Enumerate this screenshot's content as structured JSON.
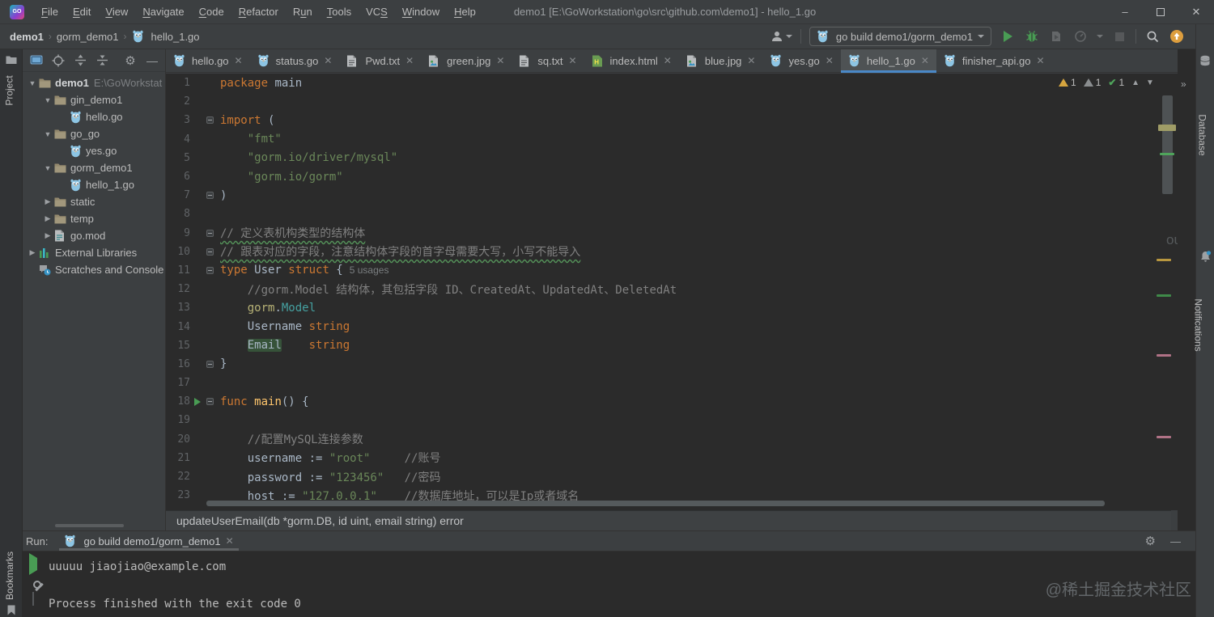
{
  "window": {
    "title": "demo1 [E:\\GoWorkstation\\go\\src\\github.com\\demo1] - hello_1.go"
  },
  "menu": {
    "items": [
      {
        "pre": "",
        "m": "F",
        "post": "ile"
      },
      {
        "pre": "",
        "m": "E",
        "post": "dit"
      },
      {
        "pre": "",
        "m": "V",
        "post": "iew"
      },
      {
        "pre": "",
        "m": "N",
        "post": "avigate"
      },
      {
        "pre": "",
        "m": "C",
        "post": "ode"
      },
      {
        "pre": "",
        "m": "R",
        "post": "efactor"
      },
      {
        "pre": "R",
        "m": "u",
        "post": "n"
      },
      {
        "pre": "",
        "m": "T",
        "post": "ools"
      },
      {
        "pre": "VC",
        "m": "S",
        "post": ""
      },
      {
        "pre": "",
        "m": "W",
        "post": "indow"
      },
      {
        "pre": "",
        "m": "H",
        "post": "elp"
      }
    ]
  },
  "breadcrumb": {
    "items": [
      "demo1",
      "gorm_demo1",
      "hello_1.go"
    ]
  },
  "run_config": {
    "label": "go build demo1/gorm_demo1"
  },
  "toolbar_icons": [
    "user",
    "run",
    "debug",
    "coverage",
    "profiler",
    "stop",
    "search",
    "update",
    "toolbox"
  ],
  "left_stripe": {
    "top": "Project",
    "bottom": "Bookmarks"
  },
  "right_stripe": {
    "items": [
      "Database",
      "Notifications"
    ]
  },
  "project": {
    "tree": [
      {
        "indent": 0,
        "chevron": "down",
        "icon": "folder",
        "label": "demo1",
        "bold": true,
        "extra": "E:\\GoWorkstat"
      },
      {
        "indent": 1,
        "chevron": "down",
        "icon": "folder",
        "label": "gin_demo1"
      },
      {
        "indent": 2,
        "chevron": null,
        "icon": "gopher",
        "label": "hello.go"
      },
      {
        "indent": 1,
        "chevron": "down",
        "icon": "folder",
        "label": "go_go"
      },
      {
        "indent": 2,
        "chevron": null,
        "icon": "gopher",
        "label": "yes.go"
      },
      {
        "indent": 1,
        "chevron": "down",
        "icon": "folder",
        "label": "gorm_demo1"
      },
      {
        "indent": 2,
        "chevron": null,
        "icon": "gopher",
        "label": "hello_1.go"
      },
      {
        "indent": 1,
        "chevron": "right",
        "icon": "folder",
        "label": "static"
      },
      {
        "indent": 1,
        "chevron": "right",
        "icon": "folder",
        "label": "temp"
      },
      {
        "indent": 1,
        "chevron": "right",
        "icon": "gomod",
        "label": "go.mod"
      },
      {
        "indent": 0,
        "chevron": "right",
        "icon": "libs",
        "label": "External Libraries"
      },
      {
        "indent": 0,
        "chevron": null,
        "icon": "scratches",
        "label": "Scratches and Console"
      }
    ]
  },
  "tabs": [
    {
      "icon": "gopher",
      "label": "hello.go"
    },
    {
      "icon": "gopher",
      "label": "status.go"
    },
    {
      "icon": "txt",
      "label": "Pwd.txt"
    },
    {
      "icon": "img",
      "label": "green.jpg"
    },
    {
      "icon": "txt",
      "label": "sq.txt"
    },
    {
      "icon": "html",
      "label": "index.html"
    },
    {
      "icon": "img",
      "label": "blue.jpg"
    },
    {
      "icon": "gopher",
      "label": "yes.go"
    },
    {
      "icon": "gopher",
      "label": "hello_1.go",
      "active": true
    },
    {
      "icon": "gopher",
      "label": "finisher_api.go"
    }
  ],
  "editor": {
    "inspections": {
      "warning_count": "1",
      "weak_warning_count": "1",
      "ok_count": "1"
    },
    "tooltip": "updateUserEmail(db *gorm.DB, id uint, email string) error",
    "faint_text": "ource",
    "lines": [
      {
        "n": 1,
        "tokens": [
          [
            "kw",
            "package"
          ],
          [
            "pl",
            " main"
          ]
        ]
      },
      {
        "n": 2,
        "tokens": []
      },
      {
        "n": 3,
        "fold": "open",
        "tokens": [
          [
            "kw",
            "import"
          ],
          [
            "pl",
            " ("
          ]
        ]
      },
      {
        "n": 4,
        "guide": true,
        "tokens": [
          [
            "pl",
            "    "
          ],
          [
            "str",
            "\"fmt\""
          ]
        ]
      },
      {
        "n": 5,
        "guide": true,
        "tokens": [
          [
            "pl",
            "    "
          ],
          [
            "str",
            "\"gorm.io/driver/mysql\""
          ]
        ]
      },
      {
        "n": 6,
        "guide": true,
        "tokens": [
          [
            "pl",
            "    "
          ],
          [
            "str",
            "\"gorm.io/gorm\""
          ]
        ]
      },
      {
        "n": 7,
        "fold": "close",
        "tokens": [
          [
            "pl",
            ")"
          ]
        ]
      },
      {
        "n": 8,
        "tokens": []
      },
      {
        "n": 9,
        "fold": "open",
        "tokens": [
          [
            "comw",
            "// 定义表机构类型的结构体"
          ]
        ]
      },
      {
        "n": 10,
        "fold": "close",
        "tokens": [
          [
            "comw",
            "// 跟表对应的字段，注意结构体字段的首字母需要大写，小写不能导入"
          ]
        ]
      },
      {
        "n": 11,
        "fold": "open",
        "tokens": [
          [
            "kw",
            "type"
          ],
          [
            "pl",
            " User "
          ],
          [
            "kw",
            "struct"
          ],
          [
            "pl",
            " {"
          ],
          [
            "hint",
            "5 usages"
          ]
        ]
      },
      {
        "n": 12,
        "guide": true,
        "tokens": [
          [
            "pl",
            "    "
          ],
          [
            "com",
            "//gorm.Model 结构体，其包括字段 ID、CreatedAt、UpdatedAt、DeletedAt"
          ]
        ]
      },
      {
        "n": 13,
        "guide": true,
        "tokens": [
          [
            "pl",
            "    "
          ],
          [
            "pkg",
            "gorm"
          ],
          [
            "pl",
            "."
          ],
          [
            "typ",
            "Model"
          ]
        ]
      },
      {
        "n": 14,
        "guide": true,
        "tokens": [
          [
            "pl",
            "    Username "
          ],
          [
            "kw",
            "string"
          ]
        ]
      },
      {
        "n": 15,
        "guide": true,
        "tokens": [
          [
            "pl",
            "    "
          ],
          [
            "hl",
            "Email"
          ],
          [
            "pl",
            "    "
          ],
          [
            "kw",
            "string"
          ]
        ]
      },
      {
        "n": 16,
        "fold": "close",
        "tokens": [
          [
            "pl",
            "}"
          ]
        ]
      },
      {
        "n": 17,
        "tokens": []
      },
      {
        "n": 18,
        "fold": "open",
        "run": true,
        "tokens": [
          [
            "kw",
            "func"
          ],
          [
            "pl",
            " "
          ],
          [
            "fn",
            "main"
          ],
          [
            "pl",
            "() {"
          ]
        ]
      },
      {
        "n": 19,
        "guide": true,
        "tokens": []
      },
      {
        "n": 20,
        "guide": true,
        "tokens": [
          [
            "pl",
            "    "
          ],
          [
            "com",
            "//配置MySQL连接参数"
          ]
        ]
      },
      {
        "n": 21,
        "guide": true,
        "tokens": [
          [
            "pl",
            "    username := "
          ],
          [
            "str",
            "\"root\""
          ],
          [
            "pl",
            "     "
          ],
          [
            "com",
            "//账号"
          ]
        ]
      },
      {
        "n": 22,
        "guide": true,
        "tokens": [
          [
            "pl",
            "    password := "
          ],
          [
            "str",
            "\"123456\""
          ],
          [
            "pl",
            "   "
          ],
          [
            "com",
            "//密码"
          ]
        ]
      },
      {
        "n": 23,
        "guide": true,
        "tokens": [
          [
            "pl",
            "    host := "
          ],
          [
            "str",
            "\"127.0.0.1\""
          ],
          [
            "pl",
            "    "
          ],
          [
            "com",
            "//数据库地址，可以是Ip或者域名"
          ]
        ]
      }
    ]
  },
  "run_panel": {
    "label": "Run:",
    "tab_label": "go build demo1/gorm_demo1",
    "output": [
      "uuuuu jiaojiao@example.com",
      "",
      "Process finished with the exit code 0"
    ]
  },
  "watermark": "@稀土掘金技术社区"
}
